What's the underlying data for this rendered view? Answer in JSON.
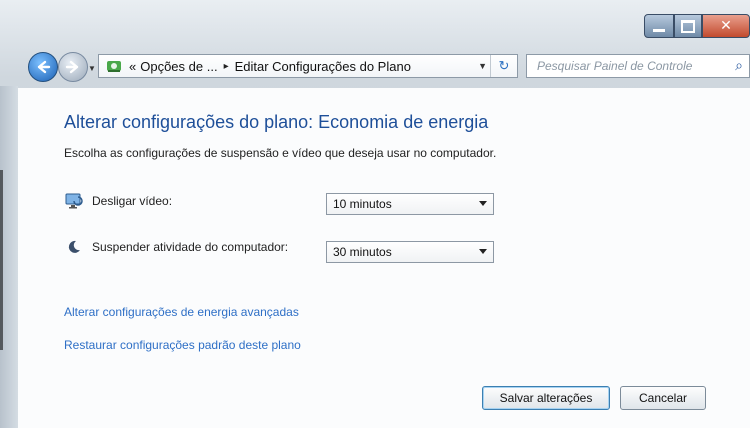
{
  "window": {
    "controls": {
      "minimize_icon": "minimize-icon",
      "maximize_icon": "maximize-icon",
      "close_icon": "close-icon",
      "close_color": "#c24a2e"
    }
  },
  "navigation": {
    "back_icon": "back-arrow-icon",
    "forward_icon": "forward-arrow-icon",
    "breadcrumb": {
      "prefix": "«",
      "root": "Opções de ...",
      "separator": "▸",
      "current": "Editar Configurações do Plano"
    },
    "refresh_icon": "refresh-icon",
    "search": {
      "placeholder": "Pesquisar Painel de Controle",
      "icon": "search-icon"
    }
  },
  "page": {
    "heading": "Alterar configurações do plano: Economia de energia",
    "subtitle": "Escolha as configurações de suspensão e vídeo que deseja usar no computador.",
    "settings": [
      {
        "label": "Desligar vídeo:",
        "value": "10 minutos",
        "icon": "monitor-icon"
      },
      {
        "label": "Suspender atividade do computador:",
        "value": "30 minutos",
        "icon": "moon-icon"
      }
    ],
    "links": {
      "advanced": "Alterar configurações de energia avançadas",
      "restore": "Restaurar configurações padrão deste plano"
    },
    "buttons": {
      "save": "Salvar alterações",
      "cancel": "Cancelar"
    },
    "accent": "#1e4f99",
    "link_color": "#2e6fc6"
  }
}
